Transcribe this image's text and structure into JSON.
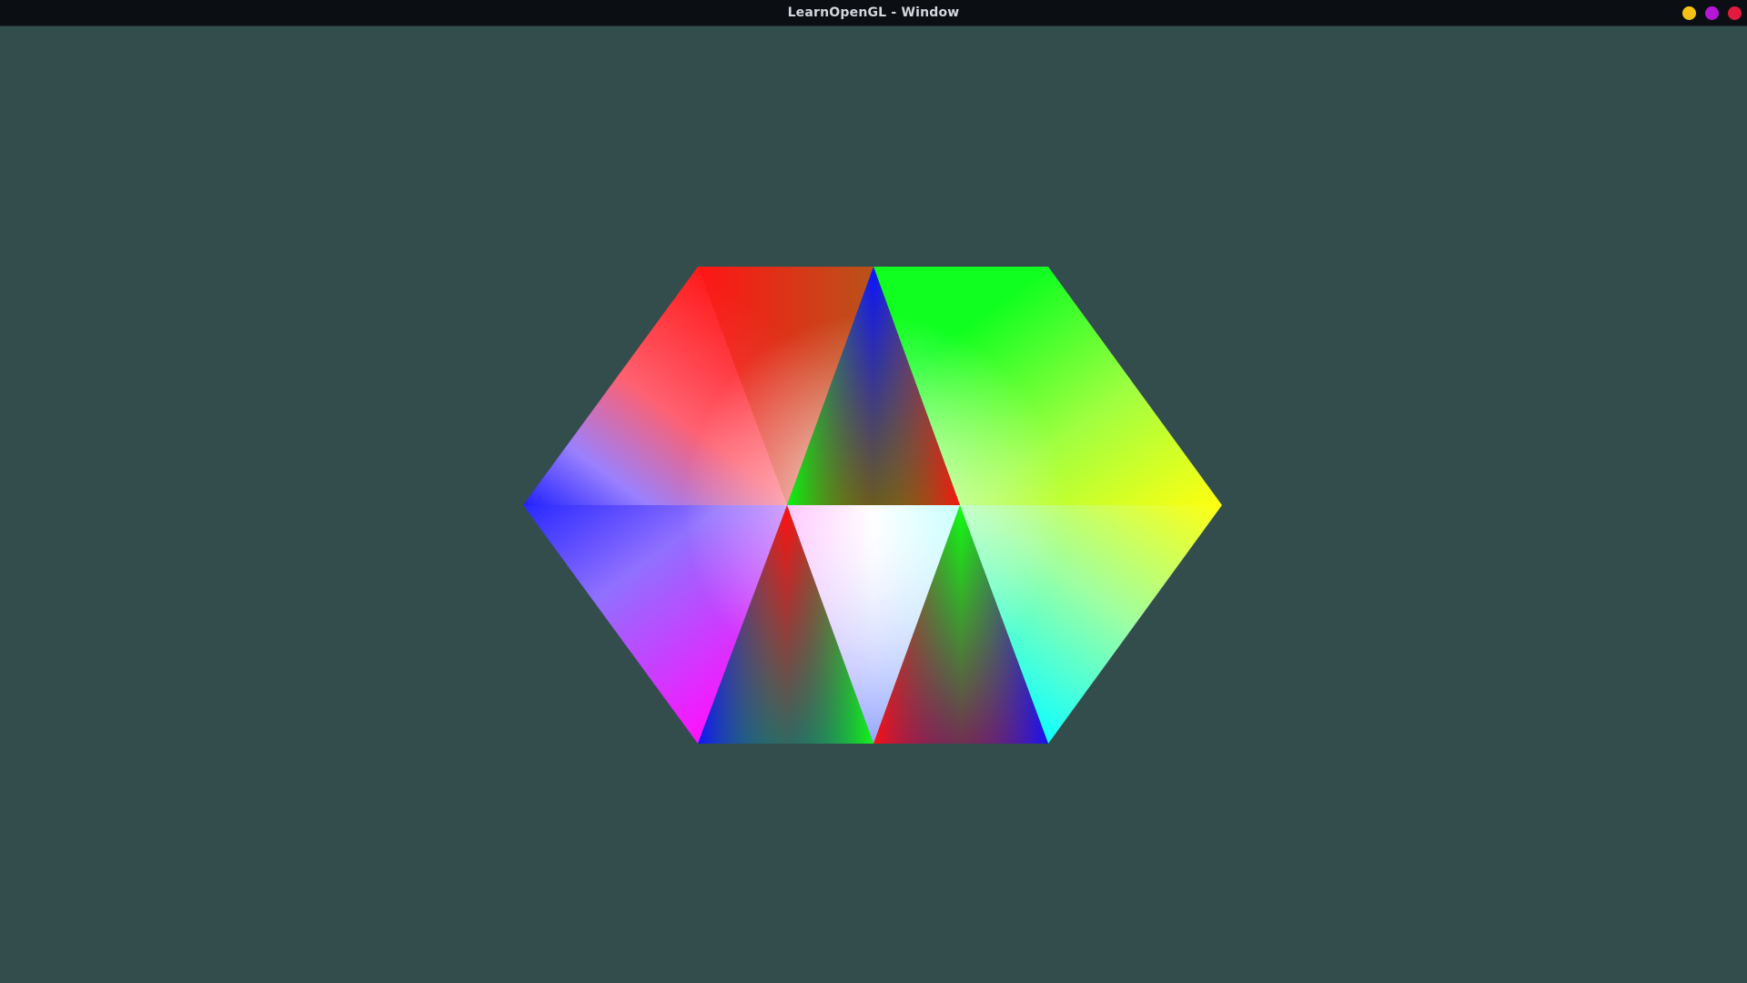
{
  "window": {
    "title": "LearnOpenGL - Window",
    "background_color": "#334d4d",
    "titlebar_color": "#0b0e13"
  },
  "controls": [
    {
      "name": "minimize-button",
      "icon": "yellow-circle-icon",
      "color": "#f5c211"
    },
    {
      "name": "maximize-button",
      "icon": "purple-circle-icon",
      "color": "#b517d6"
    },
    {
      "name": "close-button",
      "icon": "red-circle-icon",
      "color": "#e01b3f"
    }
  ]
}
